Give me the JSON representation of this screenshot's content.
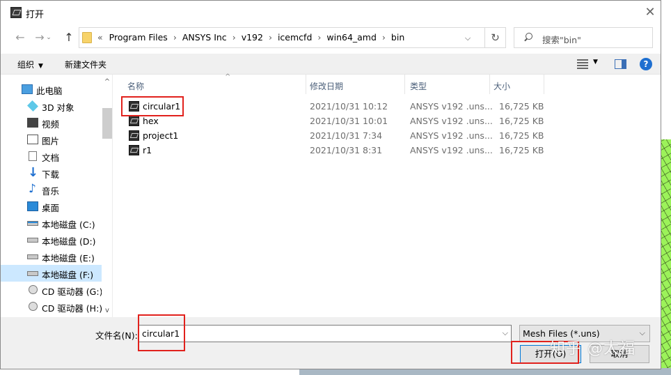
{
  "window": {
    "title": "打开",
    "close_glyph": "✕"
  },
  "nav": {
    "back_glyph": "←",
    "forward_glyph": "→",
    "up_glyph": "↑",
    "refresh_glyph": "↻",
    "dropdown_glyph": "⌵"
  },
  "address": {
    "overflow": "«",
    "crumbs": [
      "Program Files",
      "ANSYS Inc",
      "v192",
      "icemcfd",
      "win64_amd",
      "bin"
    ],
    "separator": "›"
  },
  "search": {
    "placeholder": "搜索\"bin\""
  },
  "toolbar": {
    "organize": "组织",
    "new_folder": "新建文件夹",
    "help": "?"
  },
  "sidebar": {
    "scroll_up": "^",
    "scroll_down": "v",
    "items": [
      {
        "label": "此电脑",
        "icon": "computer-icon"
      },
      {
        "label": "3D 对象",
        "icon": "3d-objects-icon"
      },
      {
        "label": "视频",
        "icon": "video-icon"
      },
      {
        "label": "图片",
        "icon": "pictures-icon"
      },
      {
        "label": "文档",
        "icon": "documents-icon"
      },
      {
        "label": "下载",
        "icon": "download-icon"
      },
      {
        "label": "音乐",
        "icon": "music-icon"
      },
      {
        "label": "桌面",
        "icon": "desktop-icon"
      },
      {
        "label": "本地磁盘 (C:)",
        "icon": "system-drive-icon"
      },
      {
        "label": "本地磁盘 (D:)",
        "icon": "drive-icon"
      },
      {
        "label": "本地磁盘 (E:)",
        "icon": "drive-icon"
      },
      {
        "label": "本地磁盘 (F:)",
        "icon": "drive-icon",
        "selected": true
      },
      {
        "label": "CD 驱动器 (G:) .",
        "icon": "cd-drive-icon"
      },
      {
        "label": "CD 驱动器 (H:) .",
        "icon": "cd-drive-icon"
      }
    ]
  },
  "columns": {
    "name": "名称",
    "date": "修改日期",
    "type": "类型",
    "size": "大小",
    "sort_glyph": "^"
  },
  "files": [
    {
      "name": "circular1",
      "date": "2021/10/31 10:12",
      "type": "ANSYS v192 .uns...",
      "size": "16,725 KB"
    },
    {
      "name": "hex",
      "date": "2021/10/31 10:01",
      "type": "ANSYS v192 .uns...",
      "size": "16,725 KB"
    },
    {
      "name": "project1",
      "date": "2021/10/31 7:34",
      "type": "ANSYS v192 .uns...",
      "size": "16,725 KB"
    },
    {
      "name": "r1",
      "date": "2021/10/31 8:31",
      "type": "ANSYS v192 .uns...",
      "size": "16,725 KB"
    }
  ],
  "bottom": {
    "filename_label": "文件名(N):",
    "filename_value": "circular1",
    "filter_value": "Mesh Files (*.uns)",
    "open_button": "打开(O)",
    "cancel_button": "取消"
  },
  "watermark": "知乎 @太福",
  "colors": {
    "highlight": "#e1211c",
    "selected": "#cce8ff",
    "accent": "#0078d7"
  }
}
